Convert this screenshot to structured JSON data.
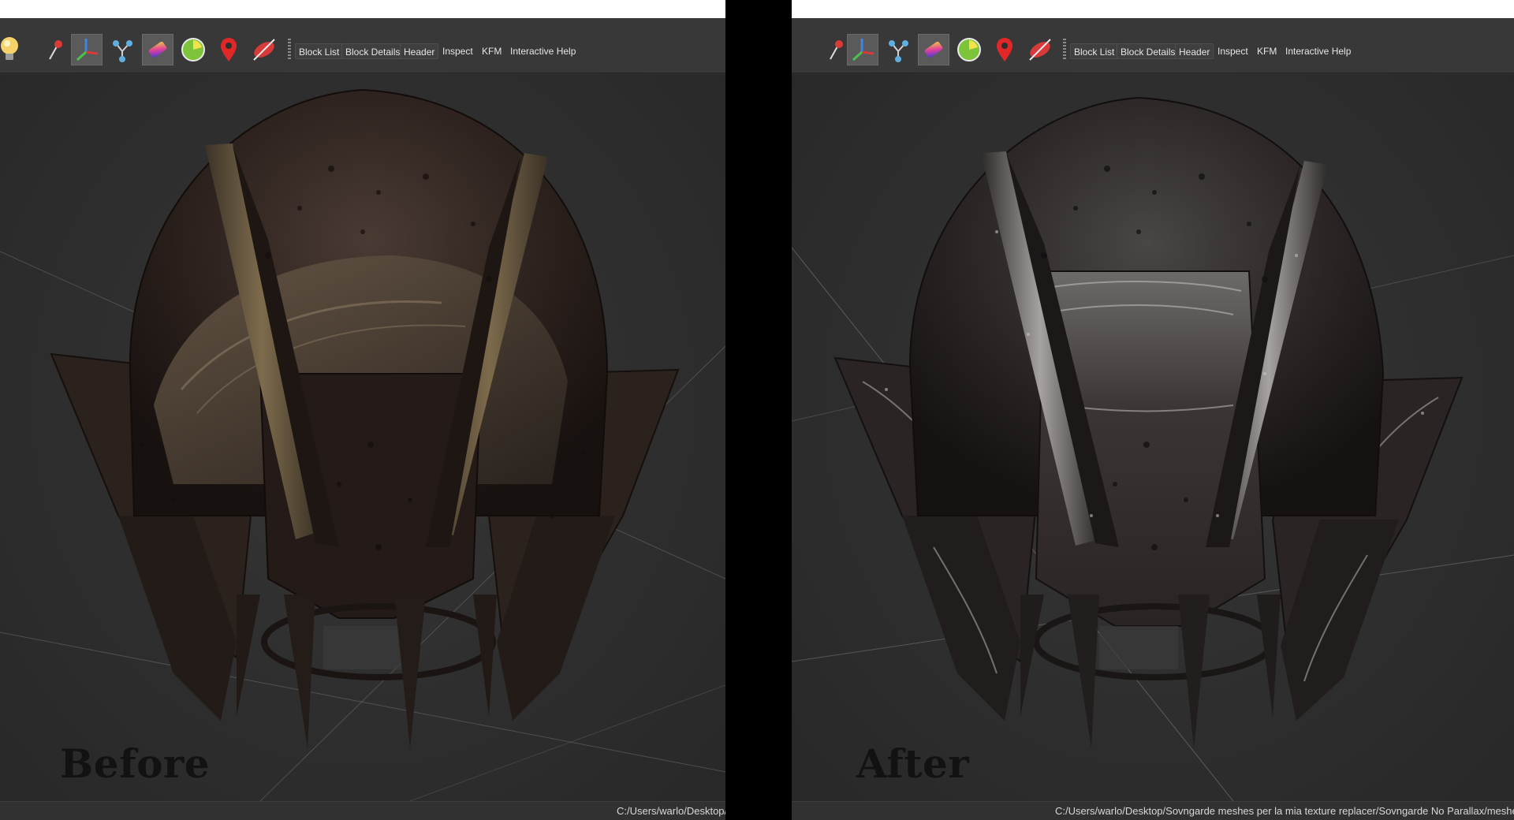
{
  "toolbar": {
    "icons": [
      {
        "name": "light-bulb-icon",
        "color": "#f6d36a"
      },
      {
        "name": "select-pin-icon",
        "color": "#d93a3a"
      },
      {
        "name": "axes-icon",
        "color": "#3f86e0"
      },
      {
        "name": "skeleton-nodes-icon",
        "color": "#5fb0e0"
      },
      {
        "name": "vertex-colors-icon",
        "color": "#e0409a"
      },
      {
        "name": "radar-icon",
        "color": "#7ec43a"
      },
      {
        "name": "location-marker-icon",
        "color": "#e02828"
      },
      {
        "name": "hide-collision-icon",
        "color": "#d83a3a"
      }
    ],
    "buttons": {
      "block_list": "Block List",
      "block_details": "Block Details",
      "header": "Header",
      "inspect": "Inspect",
      "kfm": "KFM",
      "interactive_help": "Interactive Help"
    }
  },
  "left_panel": {
    "caption": "Before",
    "status_path": "C:/Users/warlo/Desktop/S"
  },
  "right_panel": {
    "caption": "After",
    "status_path": "C:/Users/warlo/Desktop/Sovngarde meshes per la mia texture replacer/Sovngarde No Parallax/meshes/arch"
  },
  "colors": {
    "viewport_bg": "#2e2e2e",
    "toolbar_bg": "#383838",
    "helmet_dark": "#1f1816",
    "helmet_mid": "#3d302b",
    "bronze": "#6f5e42",
    "silver_highlight": "#9a9a9a"
  }
}
